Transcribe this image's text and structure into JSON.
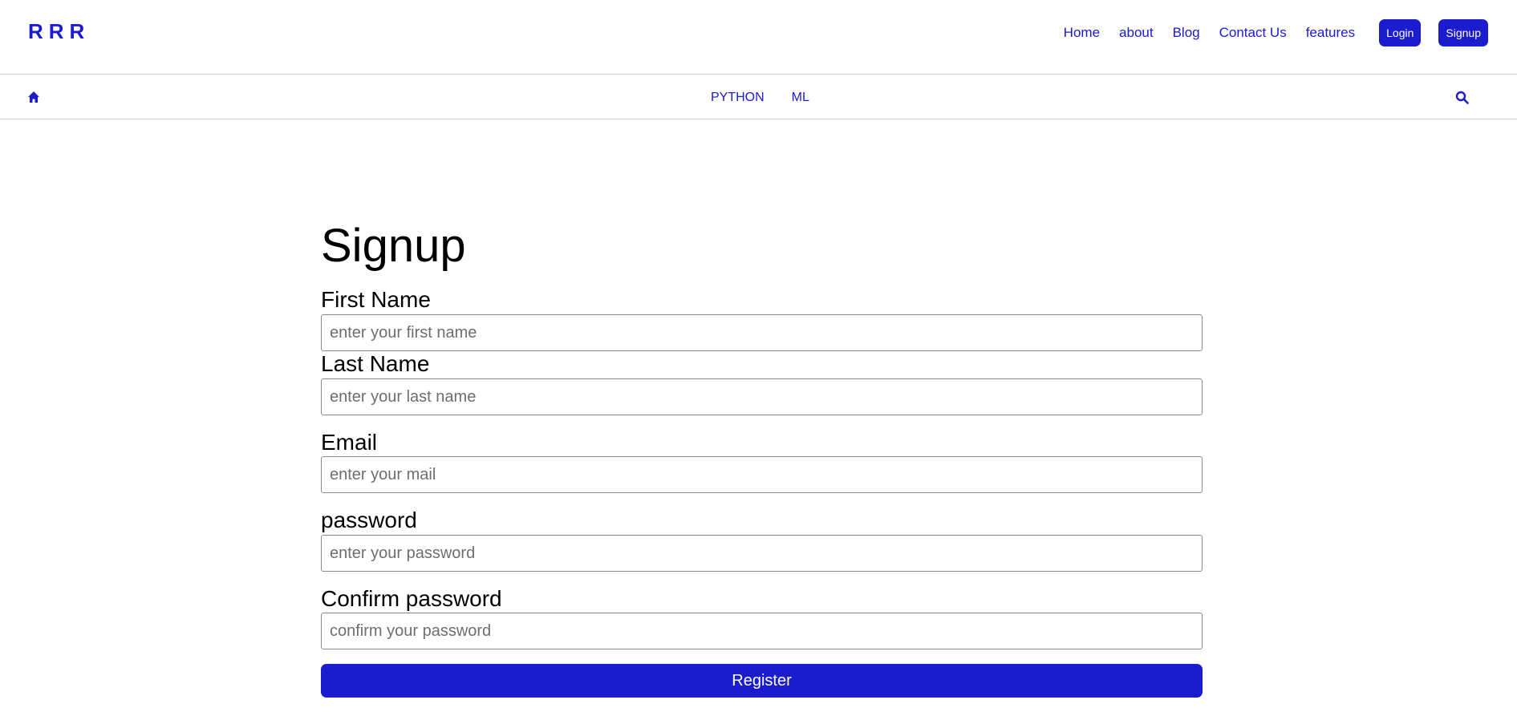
{
  "brand": "RRR",
  "nav": {
    "links": [
      "Home",
      "about",
      "Blog",
      "Contact Us",
      "features"
    ],
    "login_label": "Login",
    "signup_label": "Signup"
  },
  "subnav": {
    "home_icon": "home-icon",
    "categories": [
      "PYTHON",
      "ML"
    ],
    "search_icon": "search-icon"
  },
  "form": {
    "title": "Signup",
    "fields": [
      {
        "label": "First Name",
        "placeholder": "enter your first name",
        "value": ""
      },
      {
        "label": "Last Name",
        "placeholder": "enter your last name",
        "value": ""
      },
      {
        "label": "Email",
        "placeholder": "enter your mail",
        "value": ""
      },
      {
        "label": "password",
        "placeholder": "enter your password",
        "value": ""
      },
      {
        "label": "Confirm password",
        "placeholder": "confirm your password",
        "value": ""
      }
    ],
    "submit_label": "Register"
  },
  "colors": {
    "accent": "#1b1bd0",
    "divider": "#c9cdf2"
  }
}
